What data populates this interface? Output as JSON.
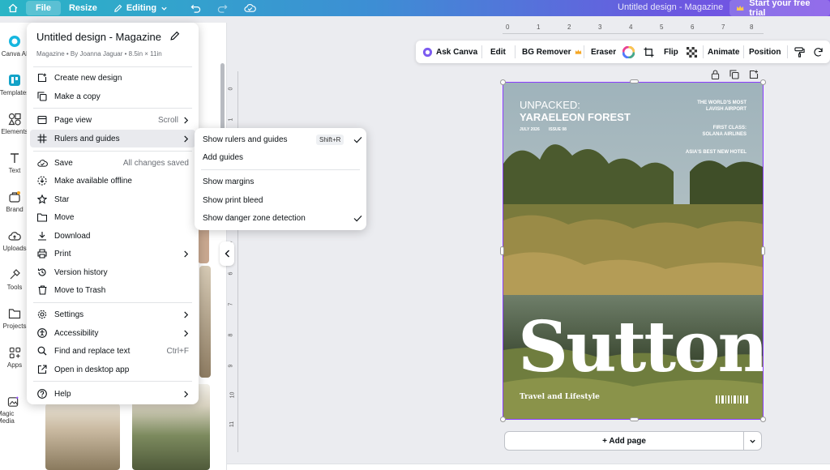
{
  "topbar": {
    "file": "File",
    "resize": "Resize",
    "editing": "Editing",
    "doc_title": "Untitled design - Magazine",
    "trial": "Start your free trial"
  },
  "rail": [
    {
      "label": "Canva AI",
      "icon": "canva-ai-icon"
    },
    {
      "label": "Templates",
      "icon": "templates-icon"
    },
    {
      "label": "Elements",
      "icon": "elements-icon"
    },
    {
      "label": "Text",
      "icon": "text-icon"
    },
    {
      "label": "Brand",
      "icon": "brand-icon"
    },
    {
      "label": "Uploads",
      "icon": "uploads-icon"
    },
    {
      "label": "Tools",
      "icon": "tools-icon"
    },
    {
      "label": "Projects",
      "icon": "projects-icon"
    },
    {
      "label": "Apps",
      "icon": "apps-icon"
    },
    {
      "label": "Magic Media",
      "icon": "magic-media-icon"
    }
  ],
  "menu": {
    "title": "Untitled design - Magazine",
    "subtitle": "Magazine • By Joanna Jaguar • 8.5in × 11in",
    "items": {
      "create_new": "Create new design",
      "make_copy": "Make a copy",
      "page_view": "Page view",
      "page_view_value": "Scroll",
      "rulers": "Rulers and guides",
      "save": "Save",
      "save_status": "All changes saved",
      "offline": "Make available offline",
      "star": "Star",
      "move": "Move",
      "download": "Download",
      "print": "Print",
      "version_history": "Version history",
      "trash": "Move to Trash",
      "settings": "Settings",
      "accessibility": "Accessibility",
      "find_replace": "Find and replace text",
      "find_shortcut": "Ctrl+F",
      "desktop_app": "Open in desktop app",
      "help": "Help"
    }
  },
  "submenu": {
    "show_rulers": "Show rulers and guides",
    "show_rulers_shortcut": "Shift+R",
    "add_guides": "Add guides",
    "show_margins": "Show margins",
    "show_bleed": "Show print bleed",
    "show_danger": "Show danger zone detection"
  },
  "toolbar": {
    "ask_canva": "Ask Canva",
    "edit": "Edit",
    "bg_remover": "BG Remover",
    "eraser": "Eraser",
    "flip": "Flip",
    "animate": "Animate",
    "position": "Position"
  },
  "ruler_top_labels": [
    "0",
    "1",
    "2",
    "3",
    "4",
    "5",
    "6",
    "7",
    "8"
  ],
  "ruler_left_labels": [
    "0",
    "1",
    "5",
    "6",
    "7",
    "8",
    "9",
    "10",
    "11"
  ],
  "cover": {
    "unpacked": "UNPACKED:",
    "forest": "YARAELEON FOREST",
    "july": "JULY 2026",
    "issue": "ISSUE 08",
    "airport1": "THE WORLD'S MOST",
    "airport2": "LAVISH AIRPORT",
    "first1": "FIRST CLASS:",
    "first2": "SOLANA AIRLINES",
    "hotel": "ASIA'S BEST NEW HOTEL",
    "sutton": "Sutton",
    "tagline": "Travel and Lifestyle"
  },
  "add_page": "+ Add page",
  "colors": {
    "accent": "#8b3dff",
    "gradient_start": "#2ab5c6",
    "gradient_end": "#7b4de6"
  }
}
